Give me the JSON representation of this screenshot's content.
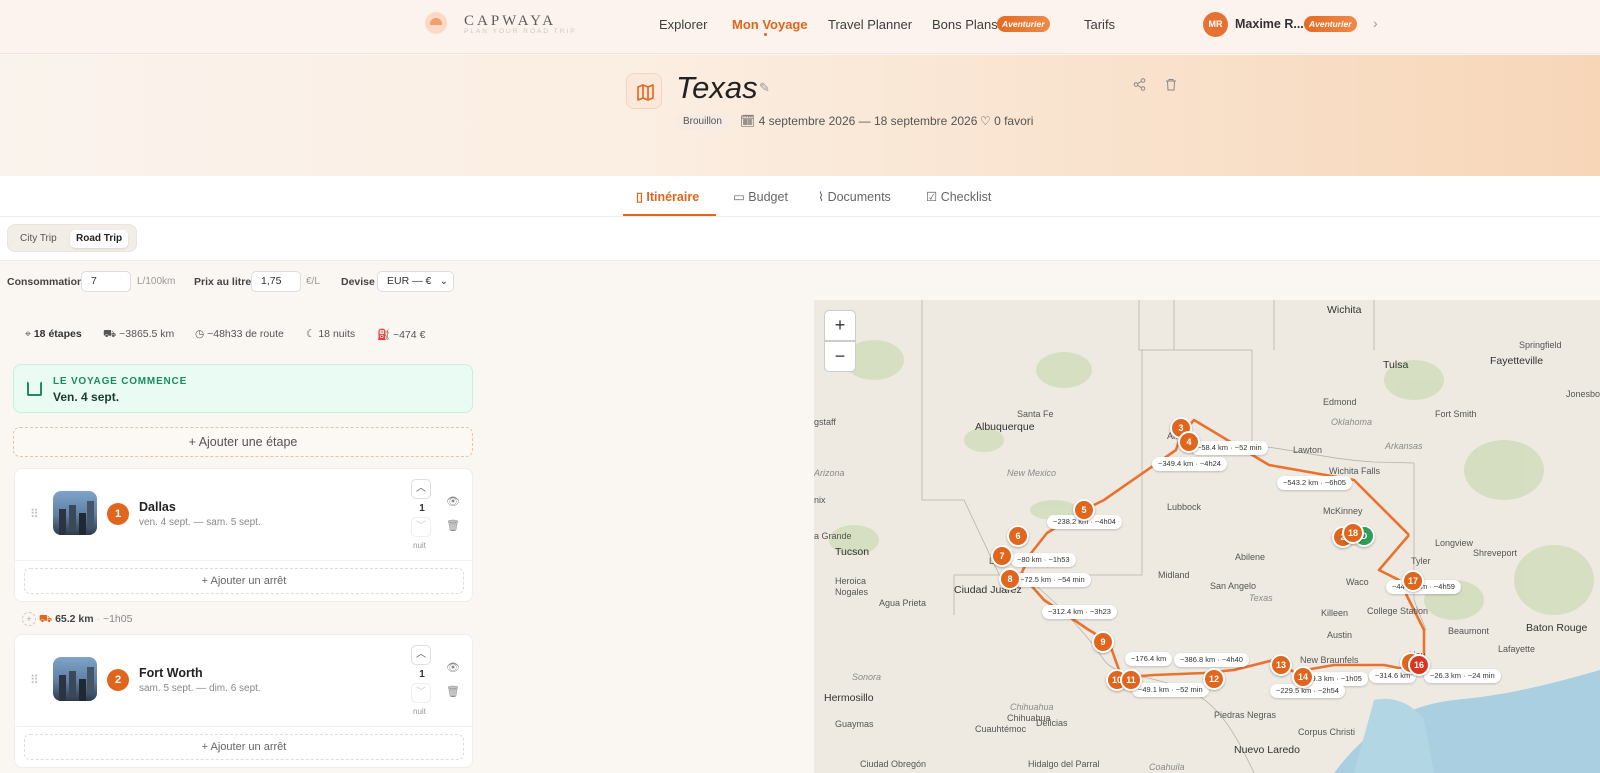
{
  "brand": {
    "name": "CAPWAYA",
    "tagline": "PLAN YOUR ROAD TRIP"
  },
  "nav": {
    "explorer": "Explorer",
    "mon_voyage": "Mon Voyage",
    "travel_planner": "Travel Planner",
    "bons_plans": "Bons Plans",
    "bons_plans_badge": "Aventurier",
    "tarifs": "Tarifs"
  },
  "user": {
    "initials": "MR",
    "name": "Maxime R...",
    "badge": "Aventurier"
  },
  "trip": {
    "title": "Texas",
    "status": "Brouillon",
    "dates": "4 septembre 2026 — 18 septembre 2026",
    "favorites": "0 favori"
  },
  "tabs": [
    "Itinéraire",
    "Budget",
    "Documents",
    "Checklist"
  ],
  "mode": {
    "city": "City Trip",
    "road": "Road Trip"
  },
  "settings": {
    "consumption_label": "Consommation",
    "consumption_value": "7",
    "consumption_unit": "L/100km",
    "price_label": "Prix au litre",
    "price_value": "1,75",
    "price_unit": "€/L",
    "currency_label": "Devise",
    "currency_value": "EUR — €"
  },
  "stats": {
    "steps": "18 étapes",
    "distance": "~3865.5 km",
    "drive_time": "~48h33 de route",
    "nights": "18 nuits",
    "fuel_cost": "~474 €"
  },
  "start": {
    "label": "LE VOYAGE COMMENCE",
    "date": "Ven. 4 sept."
  },
  "add_step": "Ajouter une étape",
  "add_stop": "Ajouter un arrêt",
  "night_label": "nuit",
  "steps": [
    {
      "num": "1",
      "name": "Dallas",
      "dates": "ven. 4 sept. — sam. 5 sept.",
      "nights": "1"
    },
    {
      "num": "2",
      "name": "Fort Worth",
      "dates": "sam. 5 sept. — dim. 6 sept.",
      "nights": "1"
    }
  ],
  "segment": {
    "distance": "65.2 km",
    "time": "~1h05"
  },
  "map": {
    "zoom_in": "+",
    "zoom_out": "−",
    "labels": {
      "wichita_top": "Wichita",
      "springfield": "Springfield",
      "tulsa": "Tulsa",
      "fayetteville": "Fayetteville",
      "jonesboro": "Jonesbo",
      "edmond": "Edmond",
      "oklahoma": "Oklahoma",
      "fort_smith": "Fort Smith",
      "arkansas": "Arkansas",
      "flagstaff": "gstaff",
      "santa_fe": "Santa Fe",
      "albuquerque": "Albuquerque",
      "amarillo": "Am",
      "lawton": "Lawton",
      "wichita_falls": "Wichita Falls",
      "new_mexico": "New Mexico",
      "arizona": "Arizona",
      "lubbock": "Lubbock",
      "mckinney": "McKinney",
      "longview": "Longview",
      "shreveport": "Shreveport",
      "tucson": "Tucson",
      "abilene": "Abilene",
      "tyler": "Tyler",
      "nix": "nix",
      "casa_grande": "a Grande",
      "heroica": "Heroica",
      "nogales": "Nogales",
      "las_cruces": "La",
      "ciudad_juarez": "Ciudad Juárez",
      "midland": "Midland",
      "san_angelo": "San Angelo",
      "texas": "Texas",
      "waco": "Waco",
      "agua_prieta": "Agua Prieta",
      "killeen": "Killeen",
      "college_station": "College Station",
      "austin": "Austin",
      "baton_rouge": "Baton Rouge",
      "beaumont": "Beaumont",
      "lafayette": "Lafayette",
      "houston": "Hou",
      "sonora": "Sonora",
      "new_braunfels": "New Braunfels",
      "hermosillo": "Hermosillo",
      "chihuahua_state": "Chihuahua",
      "chihuahua_city": "Chihuahua",
      "piedras_negras": "Piedras Negras",
      "cuauhtemoc": "Cuauhtémoc",
      "delicias": "Delicias",
      "guaymas": "Guaymas",
      "corpus": "Corpus Christi",
      "nuevo_laredo": "Nuevo Laredo",
      "ciudad_obregon": "Ciudad Obregón",
      "hidalgo": "Hidalgo del Parral",
      "coahuila": "Coahuila"
    },
    "distances": [
      "~58.4 km · ~52 min",
      "~349.4 km · ~4h24",
      "~543.2 km · ~6h05",
      "~238.2 km · ~4h04",
      "~80 km · ~1h53",
      "~72.5 km · ~54 min",
      "~442.9 km · ~4h59",
      "~312.4 km · ~3h23",
      "~176.4 km",
      "~386.8 km · ~4h40",
      "~49.1 km · ~52 min",
      "~79.3 km · ~1h05",
      "~229.5 km · ~2h54",
      "~314.6 km",
      "~26.3 km · ~24 min"
    ],
    "markers": [
      "3",
      "4",
      "5",
      "6",
      "7",
      "8",
      "9",
      "10",
      "11",
      "12",
      "13",
      "14",
      "2",
      "D",
      "1",
      "16",
      "17",
      "18"
    ]
  },
  "colors": {
    "accent": "#e0661d",
    "start_green": "#1d8a63",
    "depart_marker": "#2e9e58"
  }
}
